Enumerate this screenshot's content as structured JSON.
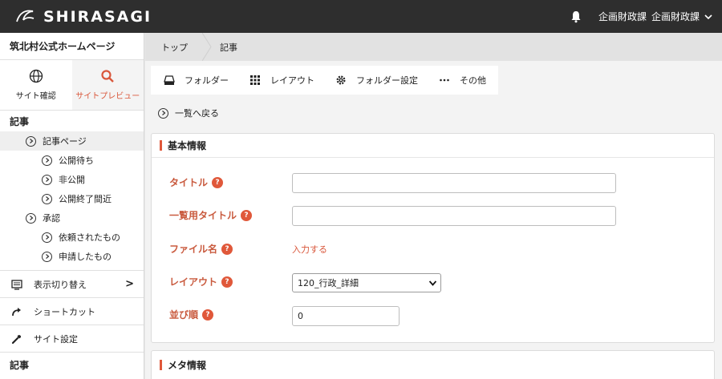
{
  "app": {
    "logo_text": "SHIRASAGI",
    "user_org": "企画財政課",
    "user_name": "企画財政課"
  },
  "sidebar": {
    "site_name": "筑北村公式ホームページ",
    "site_buttons": [
      {
        "label": "サイト確認"
      },
      {
        "label": "サイトプレビュー"
      }
    ],
    "section1": "記事",
    "tree": [
      {
        "label": "記事ページ"
      },
      {
        "label": "公開待ち"
      },
      {
        "label": "非公開"
      },
      {
        "label": "公開終了間近"
      },
      {
        "label": "承認"
      },
      {
        "label": "依頼されたもの"
      },
      {
        "label": "申請したもの"
      }
    ],
    "menu": [
      {
        "label": "表示切り替え",
        "arrow": ">"
      },
      {
        "label": "ショートカット"
      },
      {
        "label": "サイト設定"
      }
    ],
    "section2": "記事"
  },
  "breadcrumb": [
    "トップ",
    "記事"
  ],
  "toolbar": [
    {
      "label": "フォルダー"
    },
    {
      "label": "レイアウト"
    },
    {
      "label": "フォルダー設定"
    },
    {
      "label": "その他"
    }
  ],
  "back_label": "一覧へ戻る",
  "basic": {
    "title": "基本情報",
    "fields": {
      "title_label": "タイトル",
      "list_title_label": "一覧用タイトル",
      "filename_label": "ファイル名",
      "filename_link": "入力する",
      "layout_label": "レイアウト",
      "layout_value": "120_行政_詳細",
      "order_label": "並び順",
      "order_value": "0"
    },
    "help": "?"
  },
  "meta": {
    "title": "メタ情報"
  }
}
